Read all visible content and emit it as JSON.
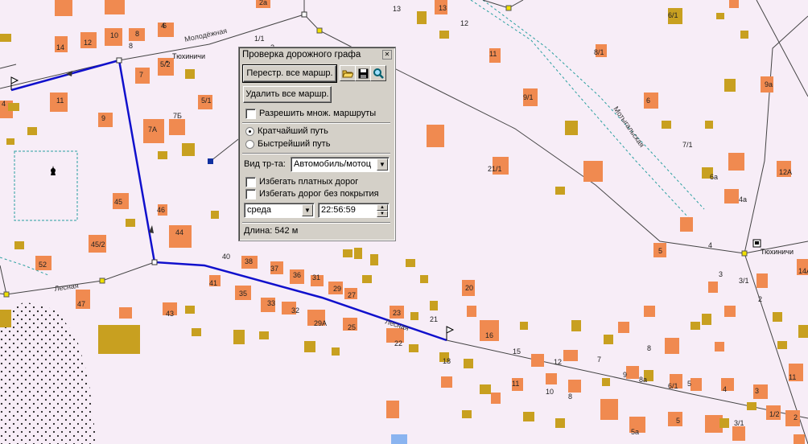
{
  "dialog": {
    "title": "Проверка дорожного графа",
    "close_glyph": "✕",
    "rebuild_button": "Перестр. все маршр.",
    "delete_button": "Удалить все маршр.",
    "allow_multiple_routes": "Разрешить множ. маршруты",
    "route_mode": {
      "shortest": "Кратчайший путь",
      "fastest": "Быстрейший путь",
      "selected": "shortest"
    },
    "vehicle_label": "Вид тр-та:",
    "vehicle_value": "Автомобиль/мотоц",
    "avoid_toll": "Избегать платных дорог",
    "avoid_unpaved": "Избегать дорог без покрытия",
    "day_value": "среда",
    "time_value": "22:56:59",
    "length_text": "Длина: 542 м"
  },
  "map": {
    "streets": [
      "Молодёжная",
      "Лесная",
      "Лесная",
      "Лесная",
      "Мотыгальская"
    ],
    "places": [
      "Тюхиничи",
      "Тюхиничи"
    ],
    "house_numbers": [
      "2а",
      "13",
      "12",
      "6/1",
      "6",
      "14",
      "12",
      "10",
      "8",
      "4",
      "1/1",
      "2",
      "11",
      "8/1",
      "7",
      "5/2",
      "5/1",
      "9/1",
      "9а",
      "11",
      "9",
      "7А",
      "7Б",
      "6",
      "7/1",
      "8",
      "21/1",
      "12А",
      "45",
      "46",
      "6а",
      "4а",
      "44",
      "45/2",
      "4",
      "4",
      "5",
      "52",
      "40",
      "38",
      "37",
      "36",
      "31",
      "29",
      "27",
      "20",
      "3",
      "3/1",
      "14А",
      "2",
      "47",
      "41",
      "35",
      "33",
      "32",
      "29А",
      "25",
      "23",
      "21",
      "16",
      "13",
      "15",
      "12",
      "7",
      "8",
      "43",
      "22",
      "18",
      "9",
      "8а",
      "6/1",
      "5",
      "4",
      "3",
      "11",
      "11",
      "10",
      "8",
      "5а",
      "5",
      "3/1",
      "1/2",
      "2"
    ],
    "route_color": "#1010cc",
    "building_orange": "#f08a50",
    "building_olive": "#c8a020"
  }
}
